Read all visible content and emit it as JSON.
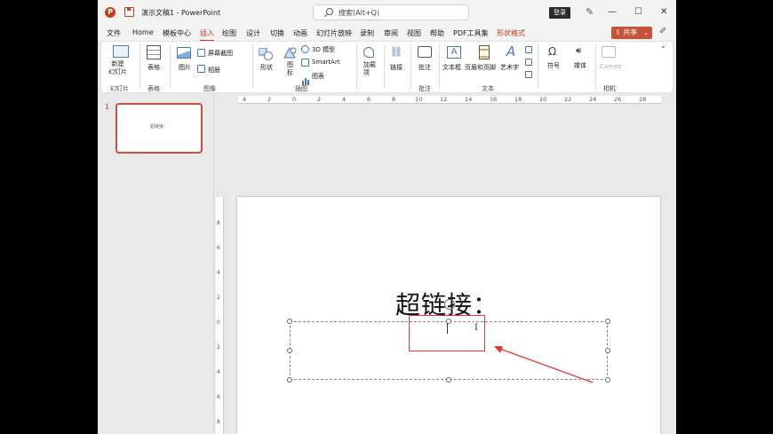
{
  "titlebar": {
    "app_logo": "P",
    "doc_title": "演示文稿1 - PowerPoint",
    "search_placeholder": "搜索(Alt+Q)",
    "login_label": "登录",
    "pen_icon": "pen-icon",
    "minimize": "—",
    "restore": "☐",
    "close": "✕"
  },
  "menu": {
    "tabs": [
      "文件",
      "Home",
      "模板中心",
      "插入",
      "绘图",
      "设计",
      "切换",
      "动画",
      "幻灯片放映",
      "录制",
      "审阅",
      "视图",
      "帮助",
      "PDF工具集",
      "形状格式"
    ],
    "active_tab": "插入",
    "contextual_tab": "形状格式",
    "share_label": "共享"
  },
  "ribbon": {
    "new_slide": "新建\n幻灯片",
    "table": "表格",
    "image": "图片",
    "screenshot": "屏幕截图",
    "album": "相册",
    "shapes": "形状",
    "icons": "图\n标",
    "model_3d": "3D 模型",
    "smartart": "SmartArt",
    "chart": "图表",
    "addins": "加载\n项",
    "link": "链接",
    "comment": "批注",
    "textbox": "文本框",
    "header_footer": "页眉和页脚",
    "wordart": "艺术字",
    "symbols": "符号",
    "media": "媒体",
    "cameo": "Cameo",
    "groups": {
      "slides": "幻灯片",
      "tables": "表格",
      "images": "图像",
      "illustrations": "插图",
      "comments": "批注",
      "text": "文本",
      "camera": "相机"
    }
  },
  "thumbnail": {
    "number": "1",
    "text": "超链接："
  },
  "rulers": {
    "horizontal": [
      "4",
      "2",
      "0",
      "2",
      "4",
      "6",
      "8",
      "10",
      "12",
      "14",
      "16",
      "18",
      "20",
      "22",
      "24",
      "26",
      "28"
    ],
    "vertical": [
      "8",
      "6",
      "4",
      "2",
      "0",
      "2",
      "4",
      "6",
      "8"
    ]
  },
  "slide": {
    "title": "超链接：",
    "textbox_cursor": "I"
  },
  "colors": {
    "accent": "#c43e1c",
    "annotation": "#e53935"
  }
}
